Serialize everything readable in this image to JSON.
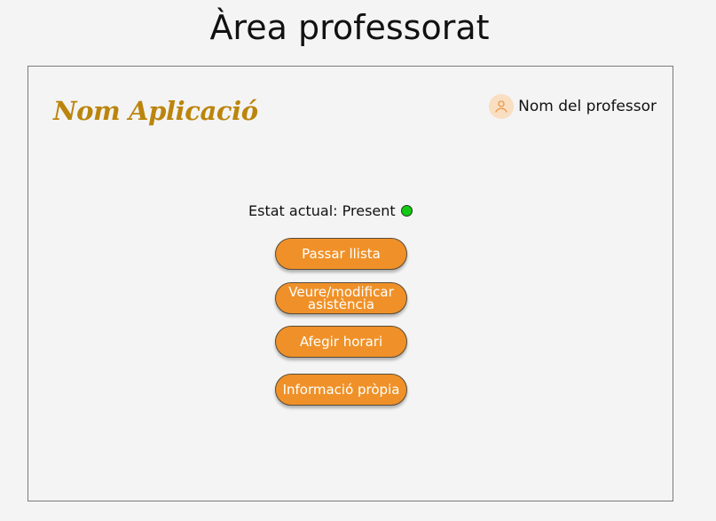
{
  "page": {
    "title": "Àrea professorat"
  },
  "header": {
    "app_name": "Nom Aplicació",
    "user": {
      "name": "Nom del professor",
      "avatar_icon": "user-icon"
    }
  },
  "status": {
    "label": "Estat actual: Present",
    "indicator_color": "#14c914"
  },
  "actions": [
    {
      "label": "Passar llista"
    },
    {
      "label": "Veure/modificar asistència"
    },
    {
      "label": "Afegir horari"
    },
    {
      "label": "Informació pròpia"
    }
  ],
  "colors": {
    "brand": "#bb850d",
    "button": "#ef9128",
    "avatar_bg": "#f9dec1"
  }
}
